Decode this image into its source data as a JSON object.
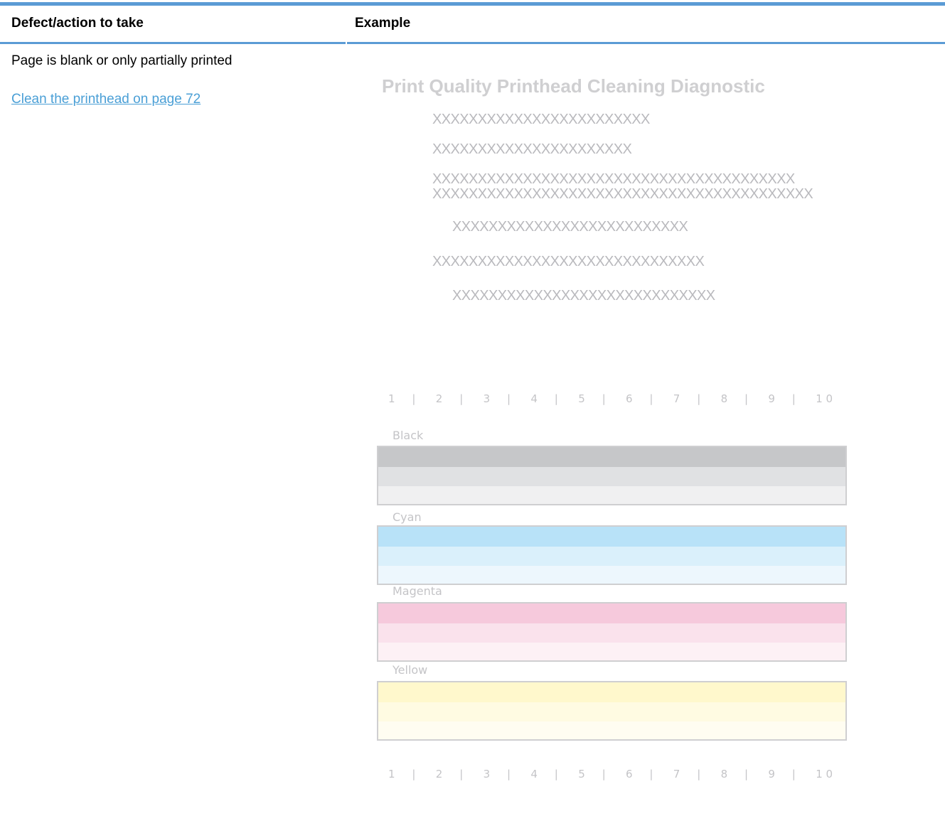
{
  "table": {
    "headers": [
      "Defect/action to take",
      "Example"
    ],
    "rows": [
      {
        "defect": "Page is blank or only partially printed",
        "action_link": "Clean the printhead on page 72"
      }
    ]
  },
  "example": {
    "title": "Print Quality Printhead Cleaning Diagnostic",
    "x_lines": [
      "XXXXXXXXXXXXXXXXXXXXXXXX",
      "XXXXXXXXXXXXXXXXXXXXXX",
      "XXXXXXXXXXXXXXXXXXXXXXXXXXXXXXXXXXXXXXXX",
      "XXXXXXXXXXXXXXXXXXXXXXXXXXXXXXXXXXXXXXXXXX",
      "XXXXXXXXXXXXXXXXXXXXXXXXXX",
      "XXXXXXXXXXXXXXXXXXXXXXXXXXXXXX",
      "XXXXXXXXXXXXXXXXXXXXXXXXXXXXX"
    ],
    "ruler_labels": [
      "1",
      "|",
      "2",
      "|",
      "3",
      "|",
      "4",
      "|",
      "5",
      "|",
      "6",
      "|",
      "7",
      "|",
      "8",
      "|",
      "9",
      "|",
      "1 0"
    ],
    "color_blocks": [
      {
        "name": "Black",
        "colors": [
          "#c6c7c9",
          "#e0e1e3",
          "#f0f0f1"
        ]
      },
      {
        "name": "Cyan",
        "colors": [
          "#b8e2f8",
          "#daf0fb",
          "#edf7fd"
        ]
      },
      {
        "name": "Magenta",
        "colors": [
          "#f6c9dc",
          "#fae2ec",
          "#fdf1f5"
        ]
      },
      {
        "name": "Yellow",
        "colors": [
          "#fff8cc",
          "#fffbe2",
          "#fffdf1"
        ]
      }
    ]
  },
  "colors": {
    "accent_rule": "#5b9bd5",
    "link": "#4a9fd6",
    "faded_text": "#b9b9bd"
  }
}
